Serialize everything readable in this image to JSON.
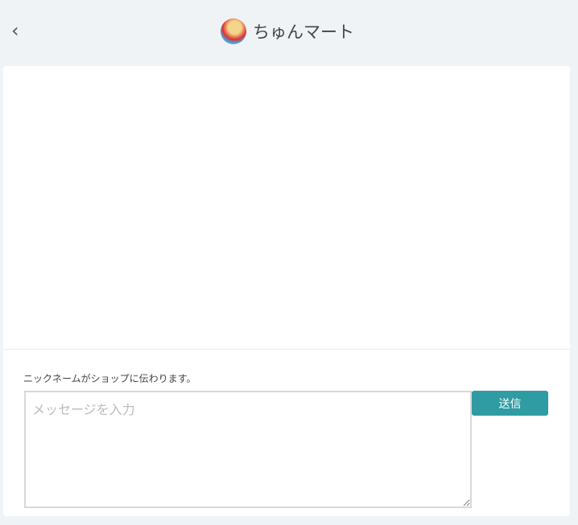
{
  "header": {
    "back_icon": "chevron-left",
    "shop_name": "ちゅんマート"
  },
  "compose": {
    "note": "ニックネームがショップに伝わります。",
    "placeholder": "メッセージを入力",
    "send_label": "送信"
  },
  "colors": {
    "accent": "#2f9ba3"
  }
}
